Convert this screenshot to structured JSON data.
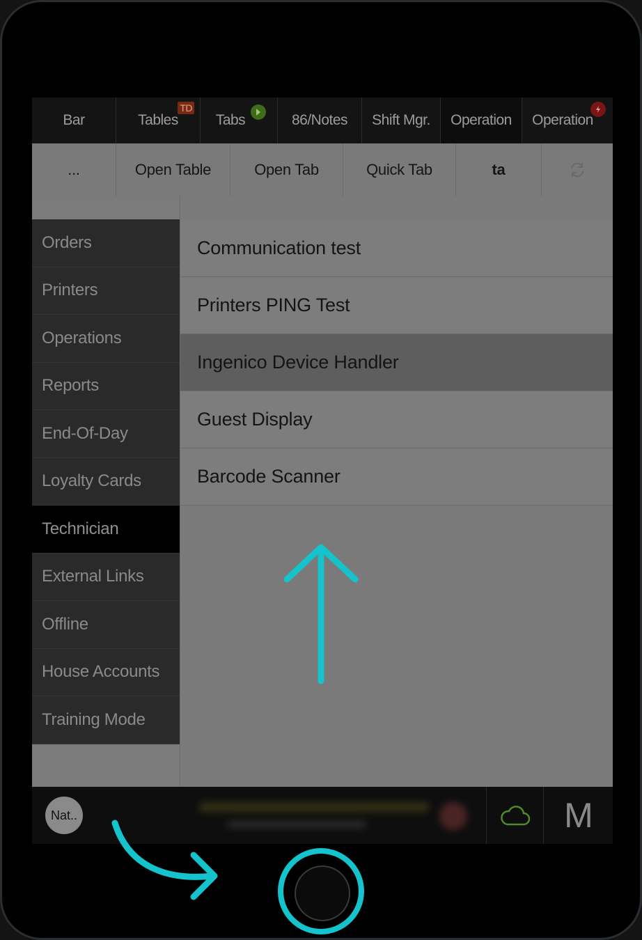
{
  "topnav": {
    "tabs": [
      {
        "label": "Bar"
      },
      {
        "label": "Tables",
        "badge": "TD"
      },
      {
        "label": "Tabs"
      },
      {
        "label": "86/Notes"
      },
      {
        "label": "Shift Mgr."
      },
      {
        "label": "Operation"
      },
      {
        "label": "Operation"
      }
    ]
  },
  "toolbar": {
    "buttons": [
      {
        "label": "..."
      },
      {
        "label": "Open Table"
      },
      {
        "label": "Open Tab"
      },
      {
        "label": "Quick Tab"
      },
      {
        "label": "ta"
      }
    ],
    "refresh_icon": "refresh-icon"
  },
  "sidebar": {
    "items": [
      {
        "label": "Orders"
      },
      {
        "label": "Printers"
      },
      {
        "label": "Operations"
      },
      {
        "label": "Reports"
      },
      {
        "label": "End-Of-Day"
      },
      {
        "label": "Loyalty Cards"
      },
      {
        "label": "Technician",
        "active": true
      },
      {
        "label": "External Links"
      },
      {
        "label": "Offline"
      },
      {
        "label": "House Accounts"
      },
      {
        "label": "Training Mode"
      }
    ]
  },
  "main": {
    "items": [
      {
        "label": "Communication test"
      },
      {
        "label": "Printers PING Test"
      },
      {
        "label": "Ingenico Device Handler",
        "highlighted": true
      },
      {
        "label": "Guest Display"
      },
      {
        "label": "Barcode Scanner"
      }
    ]
  },
  "bottombar": {
    "avatar_label": "Nat..",
    "cloud_icon": "cloud-icon",
    "m_label": "M"
  },
  "colors": {
    "accent_cyan": "#14c3cc",
    "cloud_green": "#4f8a2a"
  }
}
